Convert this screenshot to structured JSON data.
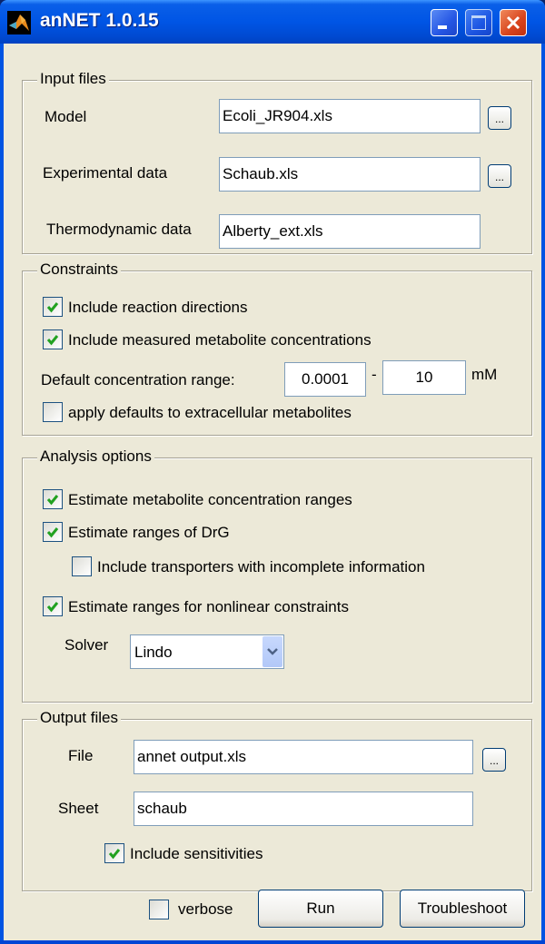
{
  "window": {
    "title": "anNET 1.0.15",
    "controls": [
      "minimize",
      "maximize",
      "close"
    ]
  },
  "input_files": {
    "legend": "Input files",
    "model": {
      "label": "Model",
      "value": "Ecoli_JR904.xls",
      "browse": "..."
    },
    "experimental": {
      "label": "Experimental data",
      "value": "Schaub.xls",
      "browse": "..."
    },
    "thermo": {
      "label": "Thermodynamic data",
      "value": "Alberty_ext.xls"
    }
  },
  "constraints": {
    "legend": "Constraints",
    "reaction_directions": {
      "label": "Include reaction directions",
      "checked": true
    },
    "measured_conc": {
      "label": "Include measured metabolite concentrations",
      "checked": true
    },
    "default_range": {
      "label": "Default concentration range:",
      "min": "0.0001",
      "sep": "-",
      "max": "10",
      "unit": "mM"
    },
    "extracellular": {
      "label": "apply defaults to extracellular metabolites",
      "checked": false
    }
  },
  "analysis": {
    "legend": "Analysis options",
    "conc_ranges": {
      "label": "Estimate metabolite concentration ranges",
      "checked": true
    },
    "drg": {
      "label": "Estimate ranges of DrG",
      "checked": true
    },
    "transporters": {
      "label": "Include transporters with incomplete information",
      "checked": false
    },
    "nonlinear": {
      "label": "Estimate ranges for nonlinear constraints",
      "checked": true
    },
    "solver": {
      "label": "Solver",
      "value": "Lindo"
    }
  },
  "output": {
    "legend": "Output files",
    "file": {
      "label": "File",
      "value": "annet output.xls",
      "browse": "..."
    },
    "sheet": {
      "label": "Sheet",
      "value": "schaub"
    },
    "sensitivities": {
      "label": "Include sensitivities",
      "checked": true
    }
  },
  "footer": {
    "verbose": {
      "label": "verbose",
      "checked": false
    },
    "run": "Run",
    "troubleshoot": "Troubleshoot"
  },
  "colors": {
    "titlebar": "#0055e5",
    "client": "#ece9d8",
    "check": "#21a121",
    "close": "#d8431c"
  }
}
